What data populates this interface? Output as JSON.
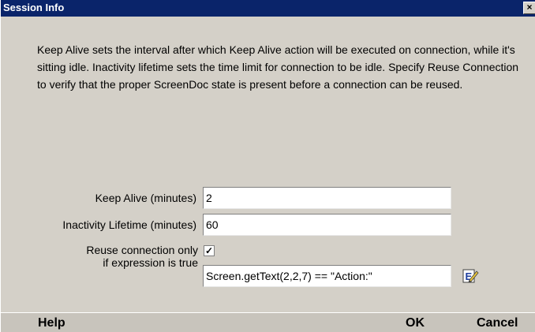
{
  "window": {
    "title": "Session Info",
    "close_label": "×"
  },
  "description": "Keep Alive sets the interval after which Keep Alive action will be executed on connection, while it's sitting idle. Inactivity lifetime sets the time limit for connection to be idle. Specify Reuse Connection to verify that the proper ScreenDoc state is present before a connection can be reused.",
  "form": {
    "keep_alive_label": "Keep Alive (minutes)",
    "keep_alive_value": "2",
    "inactivity_label": "Inactivity Lifetime (minutes)",
    "inactivity_value": "60",
    "reuse_label_line1": "Reuse connection only",
    "reuse_label_line2": "if expression is true",
    "reuse_checked": "✓",
    "expression_value": "Screen.getText(2,2,7) == \"Action:\""
  },
  "icons": {
    "edit_expression": "edit-pencil-icon"
  },
  "footer": {
    "help_label": "Help",
    "ok_label": "OK",
    "cancel_label": "Cancel"
  },
  "colors": {
    "titlebar": "#0a246a",
    "dialog_bg": "#d4d0c8",
    "footer_bg": "#c8c4bc"
  }
}
